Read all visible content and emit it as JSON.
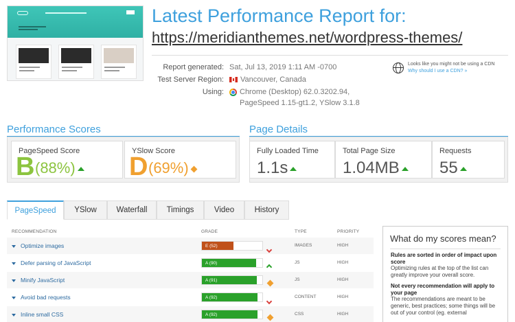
{
  "header": {
    "title": "Latest Performance Report for:",
    "url": "https://meridianthemes.net/wordpress-themes/"
  },
  "meta": {
    "report_generated_label": "Report generated:",
    "report_generated_value": "Sat, Jul 13, 2019 1:11 AM -0700",
    "server_label": "Test Server Region:",
    "server_value": "Vancouver, Canada",
    "using_label": "Using:",
    "using_value_line1": "Chrome (Desktop) 62.0.3202.94,",
    "using_value_line2": "PageSpeed 1.15-gt1.2, YSlow 3.1.8"
  },
  "cdn": {
    "line1": "Looks like you might not be using a CDN",
    "link": "Why should I use a CDN? »"
  },
  "performance_scores": {
    "heading": "Performance Scores",
    "pagespeed": {
      "label": "PageSpeed Score",
      "grade": "B",
      "percent": "(88%)",
      "trend": "up",
      "color": "#8cc43f"
    },
    "yslow": {
      "label": "YSlow Score",
      "grade": "D",
      "percent": "(69%)",
      "trend": "neutral",
      "color": "#f0a030"
    }
  },
  "page_details": {
    "heading": "Page Details",
    "fully_loaded": {
      "label": "Fully Loaded Time",
      "value": "1.1s"
    },
    "page_size": {
      "label": "Total Page Size",
      "value": "1.04MB"
    },
    "requests": {
      "label": "Requests",
      "value": "55"
    }
  },
  "tabs": [
    "PageSpeed",
    "YSlow",
    "Waterfall",
    "Timings",
    "Video",
    "History"
  ],
  "table": {
    "headers": {
      "recommendation": "RECOMMENDATION",
      "grade": "GRADE",
      "type": "TYPE",
      "priority": "PRIORITY"
    },
    "rows": [
      {
        "name": "Optimize images",
        "grade": "E (52)",
        "score": 52,
        "color": "#c0511a",
        "indicator": "down",
        "type": "IMAGES",
        "priority": "HIGH"
      },
      {
        "name": "Defer parsing of JavaScript",
        "grade": "A (90)",
        "score": 90,
        "color": "#2aa12a",
        "indicator": "up",
        "type": "JS",
        "priority": "HIGH"
      },
      {
        "name": "Minify JavaScript",
        "grade": "A (91)",
        "score": 91,
        "color": "#2aa12a",
        "indicator": "neutral",
        "type": "JS",
        "priority": "HIGH"
      },
      {
        "name": "Avoid bad requests",
        "grade": "A (92)",
        "score": 92,
        "color": "#2aa12a",
        "indicator": "down",
        "type": "CONTENT",
        "priority": "HIGH"
      },
      {
        "name": "Inline small CSS",
        "grade": "A (92)",
        "score": 92,
        "color": "#2aa12a",
        "indicator": "neutral",
        "type": "CSS",
        "priority": "HIGH"
      }
    ]
  },
  "side_box": {
    "title": "What do my scores mean?",
    "p1_bold": "Rules are sorted in order of impact upon score",
    "p1_text": "Optimizing rules at the top of the list can greatly improve your overall score.",
    "p2_bold": "Not every recommendation will apply to your page",
    "p2_text": "The recommendations are meant to be generic, best practices; some things will be out of your control (eg. external"
  }
}
